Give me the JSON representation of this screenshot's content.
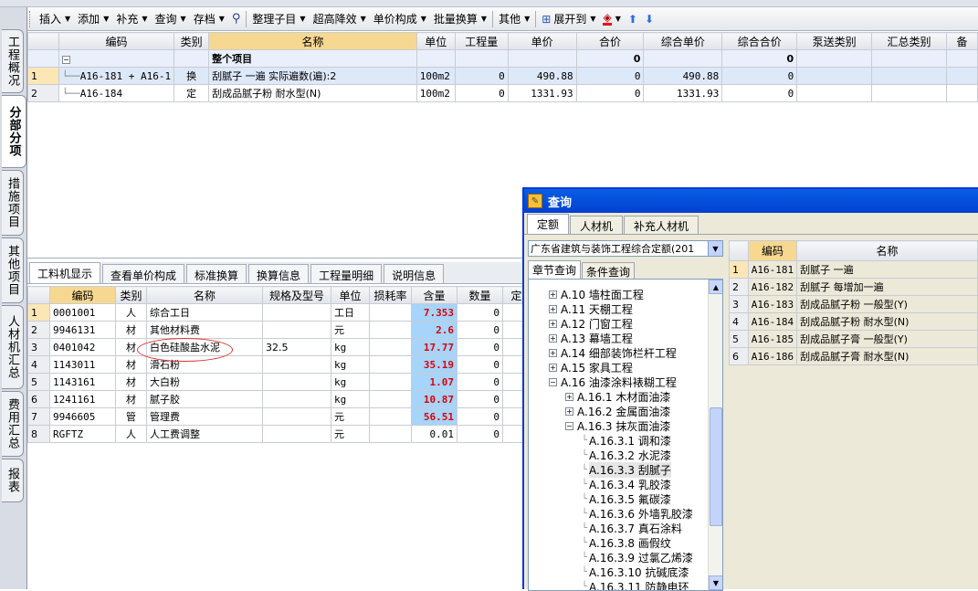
{
  "toolbar": {
    "items": [
      {
        "label": "插入",
        "dropdown": true
      },
      {
        "label": "添加",
        "dropdown": true
      },
      {
        "label": "补充",
        "dropdown": true
      },
      {
        "label": "查询",
        "dropdown": true
      },
      {
        "label": "存档",
        "dropdown": true
      },
      {
        "label": "整理子目",
        "dropdown": true
      },
      {
        "label": "超高降效",
        "dropdown": true
      },
      {
        "label": "单价构成",
        "dropdown": true
      },
      {
        "label": "批量换算",
        "dropdown": true
      },
      {
        "label": "其他",
        "dropdown": true
      },
      {
        "label": "展开到",
        "dropdown": true
      }
    ]
  },
  "left_tabs": [
    "工程概况",
    "分部分项",
    "措施项目",
    "其他项目",
    "人材机汇总",
    "费用汇总",
    "报表"
  ],
  "top_grid": {
    "headers": [
      "编码",
      "类别",
      "名称",
      "单位",
      "工程量",
      "单价",
      "合价",
      "综合单价",
      "综合合价",
      "泵送类别",
      "汇总类别",
      "备"
    ],
    "group_row": {
      "toggle": "−",
      "name": "整个项目",
      "total": "0",
      "total2": "0"
    },
    "rows": [
      {
        "n": "1",
        "code": "A16-181 + A16-1",
        "type": "换",
        "name": "刮腻子 一遍 实际遍数(遍):2",
        "unit": "100m2",
        "qty": "0",
        "price": "490.88",
        "total": "0",
        "cprice": "490.88",
        "ctotal": "0"
      },
      {
        "n": "2",
        "code": "A16-184",
        "type": "定",
        "name": "刮成品腻子粉 耐水型(N)",
        "unit": "100m2",
        "qty": "0",
        "price": "1331.93",
        "total": "0",
        "cprice": "1331.93",
        "ctotal": "0"
      }
    ]
  },
  "bottom_tabs": [
    "工料机显示",
    "查看单价构成",
    "标准换算",
    "换算信息",
    "工程量明细",
    "说明信息"
  ],
  "bottom_grid": {
    "headers": [
      "编码",
      "类别",
      "名称",
      "规格及型号",
      "单位",
      "损耗率",
      "含量",
      "数量",
      "定"
    ],
    "rows": [
      {
        "n": "1",
        "code": "0001001",
        "type": "人",
        "name": "综合工日",
        "spec": "",
        "unit": "工日",
        "content": "7.353",
        "qty": "0"
      },
      {
        "n": "2",
        "code": "9946131",
        "type": "材",
        "name": "其他材料费",
        "spec": "",
        "unit": "元",
        "content": "2.6",
        "qty": "0"
      },
      {
        "n": "3",
        "code": "0401042",
        "type": "材",
        "name": "白色硅酸盐水泥",
        "spec": "32.5",
        "unit": "kg",
        "content": "17.77",
        "qty": "0"
      },
      {
        "n": "4",
        "code": "1143011",
        "type": "材",
        "name": "滑石粉",
        "spec": "",
        "unit": "kg",
        "content": "35.19",
        "qty": "0"
      },
      {
        "n": "5",
        "code": "1143161",
        "type": "材",
        "name": "大白粉",
        "spec": "",
        "unit": "kg",
        "content": "1.07",
        "qty": "0"
      },
      {
        "n": "6",
        "code": "1241161",
        "type": "材",
        "name": "腻子胶",
        "spec": "",
        "unit": "kg",
        "content": "10.87",
        "qty": "0"
      },
      {
        "n": "7",
        "code": "9946605",
        "type": "管",
        "name": "管理费",
        "spec": "",
        "unit": "元",
        "content": "56.51",
        "qty": "0"
      },
      {
        "n": "8",
        "code": "RGFTZ",
        "type": "人",
        "name": "人工费调整",
        "spec": "",
        "unit": "元",
        "content": "0.01",
        "qty": "0"
      }
    ]
  },
  "query": {
    "title": "查询",
    "tabs": [
      "定额",
      "人材机",
      "补充人材机"
    ],
    "library": "广东省建筑与装饰工程综合定额(201",
    "subtabs": [
      "章节查询",
      "条件查询"
    ],
    "tree": [
      {
        "label": "A.10 墙柱面工程",
        "level": 0,
        "toggle": "+"
      },
      {
        "label": "A.11 天棚工程",
        "level": 0,
        "toggle": "+"
      },
      {
        "label": "A.12 门窗工程",
        "level": 0,
        "toggle": "+"
      },
      {
        "label": "A.13 幕墙工程",
        "level": 0,
        "toggle": "+"
      },
      {
        "label": "A.14 细部装饰栏杆工程",
        "level": 0,
        "toggle": "+"
      },
      {
        "label": "A.15 家具工程",
        "level": 0,
        "toggle": "+"
      },
      {
        "label": "A.16 油漆涂料裱糊工程",
        "level": 0,
        "toggle": "−"
      },
      {
        "label": "A.16.1 木材面油漆",
        "level": 1,
        "toggle": "+"
      },
      {
        "label": "A.16.2 金属面油漆",
        "level": 1,
        "toggle": "+"
      },
      {
        "label": "A.16.3 抹灰面油漆",
        "level": 1,
        "toggle": "−"
      },
      {
        "label": "A.16.3.1 调和漆",
        "level": 2,
        "toggle": ""
      },
      {
        "label": "A.16.3.2 水泥漆",
        "level": 2,
        "toggle": ""
      },
      {
        "label": "A.16.3.3 刮腻子",
        "level": 2,
        "toggle": "",
        "selected": true
      },
      {
        "label": "A.16.3.4 乳胶漆",
        "level": 2,
        "toggle": ""
      },
      {
        "label": "A.16.3.5 氟碳漆",
        "level": 2,
        "toggle": ""
      },
      {
        "label": "A.16.3.6 外墙乳胶漆",
        "level": 2,
        "toggle": ""
      },
      {
        "label": "A.16.3.7 真石涂料",
        "level": 2,
        "toggle": ""
      },
      {
        "label": "A.16.3.8 画假纹",
        "level": 2,
        "toggle": ""
      },
      {
        "label": "A.16.3.9 过氯乙烯漆",
        "level": 2,
        "toggle": ""
      },
      {
        "label": "A.16.3.10 抗碱底漆",
        "level": 2,
        "toggle": ""
      },
      {
        "label": "A.16.3.11 防静电环",
        "level": 2,
        "toggle": ""
      }
    ],
    "grid_headers": [
      "编码",
      "名称"
    ],
    "rows": [
      {
        "n": "1",
        "code": "A16-181",
        "name": "刮腻子 一遍"
      },
      {
        "n": "2",
        "code": "A16-182",
        "name": "刮腻子 每增加一遍"
      },
      {
        "n": "3",
        "code": "A16-183",
        "name": "刮成品腻子粉 一般型(Y)"
      },
      {
        "n": "4",
        "code": "A16-184",
        "name": "刮成品腻子粉 耐水型(N)"
      },
      {
        "n": "5",
        "code": "A16-185",
        "name": "刮成品腻子膏 一般型(Y)"
      },
      {
        "n": "6",
        "code": "A16-186",
        "name": "刮成品腻子膏 耐水型(N)"
      }
    ]
  },
  "colors": {
    "selected_row": "#fbe7b5",
    "content_cell": "#a6d4fb",
    "content_text": "#e00000",
    "name_header": "#f7d891",
    "query_title": "#0a5ee6"
  }
}
